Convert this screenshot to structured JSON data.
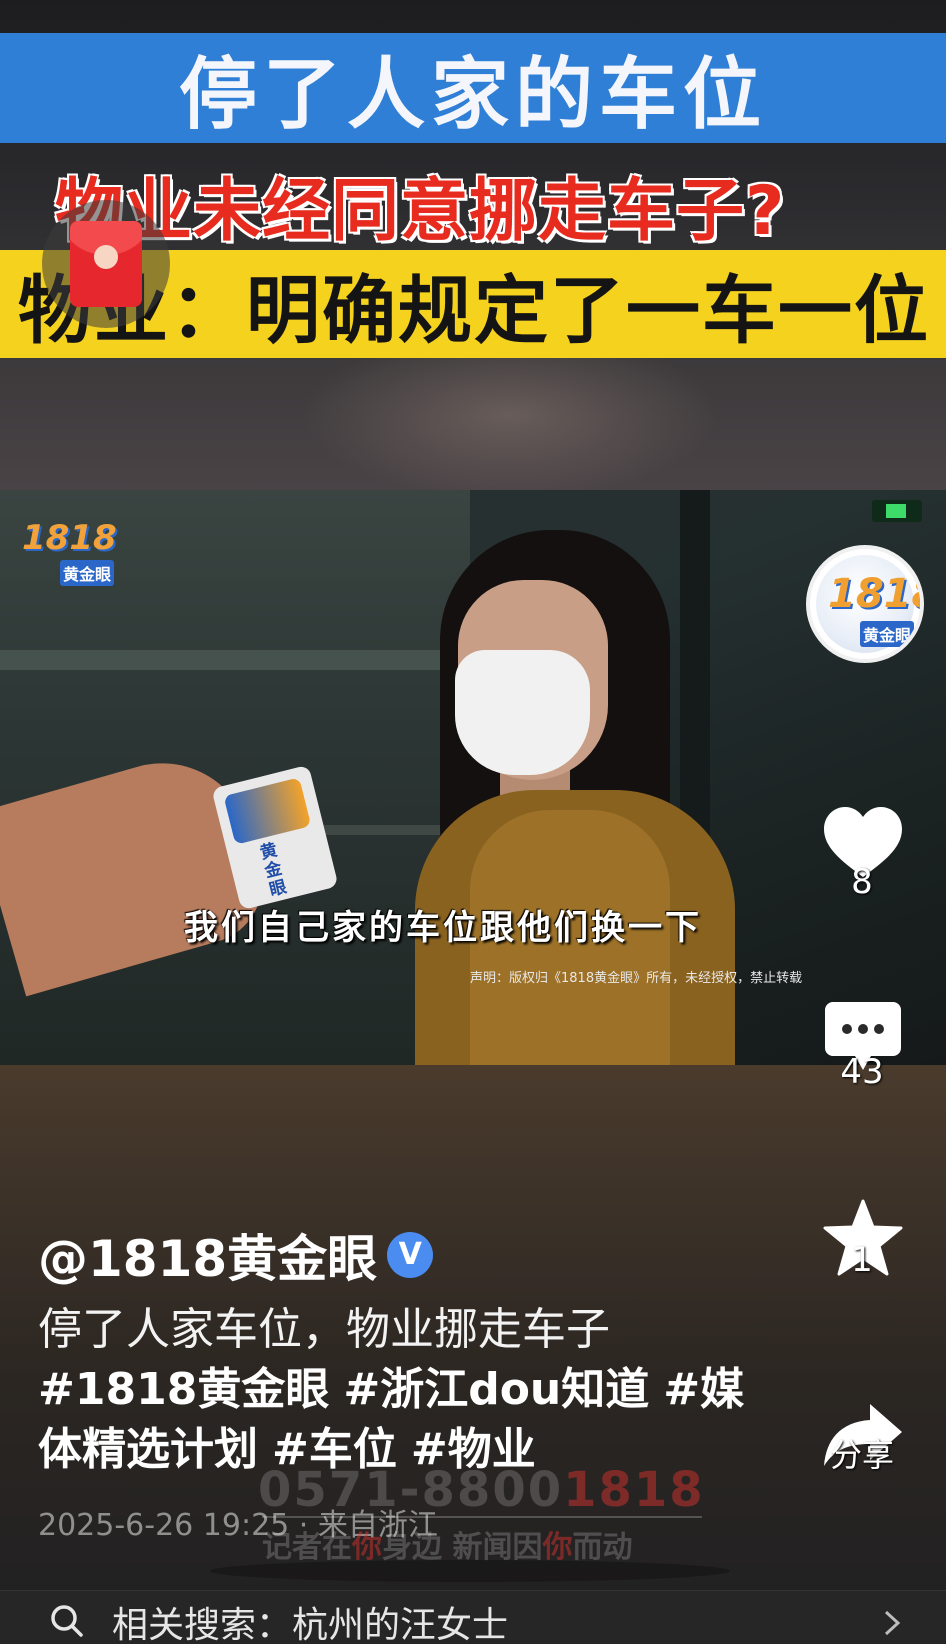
{
  "video": {
    "banner_title": "停了人家的车位",
    "red_headline": "物业未经同意挪走车子?",
    "yellow_headline": "物业：明确规定了一车一位",
    "subtitle": "我们自己家的车位跟他们换一下",
    "disclaimer": "声明：版权归《1818黄金眼》所有，未经授权，禁止转载",
    "watermark_logo_num": "1818",
    "watermark_logo_brand": "黄金眼",
    "mic_brand": "黄金眼",
    "watermark_phone_prefix": "0571-8800",
    "watermark_phone_suffix": "1818",
    "watermark_slogan_a": "记者在",
    "watermark_slogan_b": "你",
    "watermark_slogan_c": "身边 新闻因",
    "watermark_slogan_d": "你",
    "watermark_slogan_e": "而动"
  },
  "side": {
    "avatar_num": "1818",
    "avatar_brand": "黄金眼",
    "likes": "8",
    "comments": "43",
    "favorites": "1",
    "share_label": "分享",
    "icons": [
      "heart-icon",
      "comment-icon",
      "star-icon",
      "share-icon"
    ]
  },
  "post": {
    "author": "@1818黄金眼",
    "verified_mark": "V",
    "caption_text": "停了人家车位，物业挪走车子",
    "tags": [
      "#1818黄金眼",
      "#浙江dou知道",
      "#媒体精选计划",
      "#车位",
      "#物业"
    ],
    "datetime": "2025-6-26 19:25 · 来自浙江"
  },
  "related": {
    "label": "相关搜索：杭州的汪女士"
  },
  "colors": {
    "banner_blue": "#2f7fd6",
    "headline_red": "#e82b1f",
    "headline_yellow": "#f5d21e",
    "verified_blue": "#4a8cf0"
  }
}
